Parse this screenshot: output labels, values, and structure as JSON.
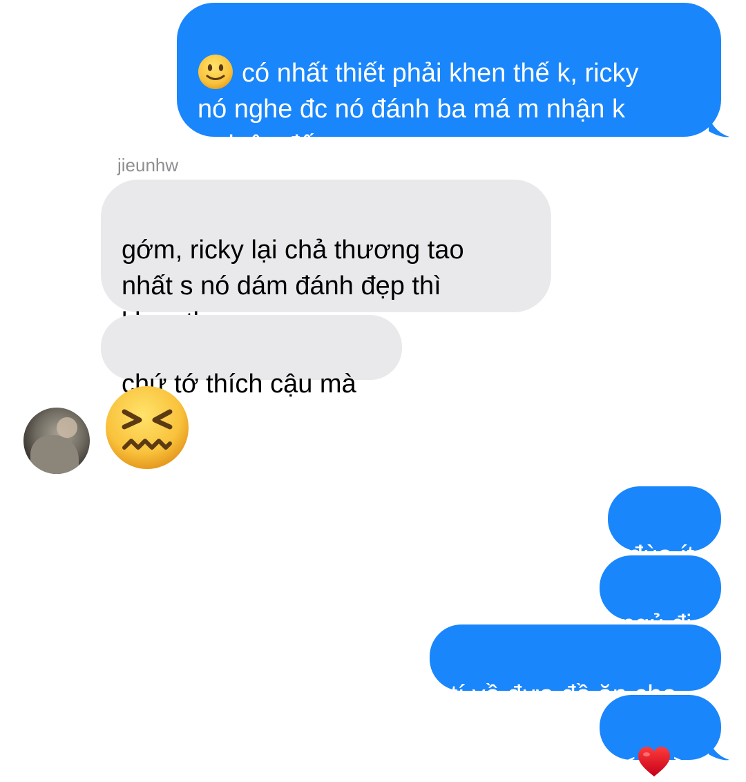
{
  "conversation": {
    "sender_name": "jieunhw",
    "avatar_icon": "contact-avatar-photo",
    "colors": {
      "outgoing": "#1a86fb",
      "incoming": "#e9e9eb"
    },
    "messages": [
      {
        "direction": "out",
        "emoji": "slightly-smiling-face",
        "text": "có nhất thiết phải khen thế k, ricky\nnó nghe đc nó đánh ba má m nhận k\nra luôn đấy"
      },
      {
        "direction": "in",
        "text": "gớm, ricky lại chả thương tao\nnhất s nó dám đánh đẹp thì\nkhen th"
      },
      {
        "direction": "in",
        "text": "chứ tớ thích cậu mà"
      },
      {
        "direction": "in",
        "emoji": "confounded-face"
      },
      {
        "direction": "out",
        "text": "đùa ít"
      },
      {
        "direction": "out",
        "text": "ngủ đi"
      },
      {
        "direction": "out",
        "text": "tí về đưa đồ ăn cho"
      },
      {
        "direction": "out",
        "prefix": "<",
        "emoji": "red-heart",
        "suffix": ">"
      }
    ]
  }
}
